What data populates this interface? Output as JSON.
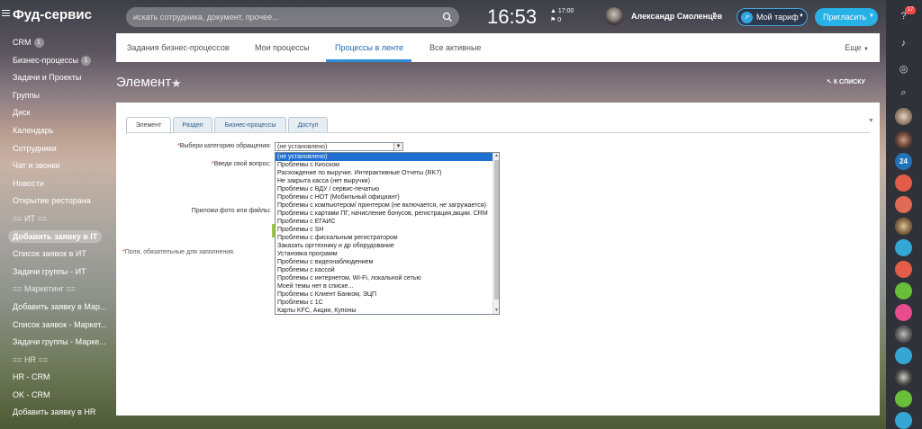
{
  "header": {
    "brand": "Фуд-сервис",
    "search_placeholder": "искать сотрудника, документ, прочее...",
    "time": "16:53",
    "alarm_time": "17:00",
    "flag_count": "0",
    "user_name": "Александр Смоленцев",
    "tariff_label": "Мой тариф",
    "invite_label": "Пригласить",
    "notification_count": "17"
  },
  "sidebar": {
    "items": [
      {
        "label": "CRM",
        "count": "1"
      },
      {
        "label": "Бизнес-процессы",
        "count": "1"
      },
      {
        "label": "Задачи и Проекты"
      },
      {
        "label": "Группы"
      },
      {
        "label": "Диск"
      },
      {
        "label": "Календарь"
      },
      {
        "label": "Сотрудники"
      },
      {
        "label": "Чат и звонки"
      },
      {
        "label": "Новости"
      },
      {
        "label": "Открытие ресторана"
      },
      {
        "label": "== ИТ =="
      },
      {
        "label": "Добавить заявку в IT"
      },
      {
        "label": "Список заявок в ИТ"
      },
      {
        "label": "Задачи группы - ИТ"
      },
      {
        "label": "== Маркетинг =="
      },
      {
        "label": "Добавить заявку в Мар..."
      },
      {
        "label": "Список заявок - Маркет..."
      },
      {
        "label": "Задачи группы - Марке..."
      },
      {
        "label": "== HR =="
      },
      {
        "label": "HR - CRM"
      },
      {
        "label": "OK - CRM"
      },
      {
        "label": "Добавить заявку в HR"
      }
    ]
  },
  "rightpanel": {
    "counter": "24"
  },
  "tabs": {
    "items": [
      "Задания бизнес-процессов",
      "Мои процессы",
      "Процессы в ленте",
      "Все активные"
    ],
    "active": "Процессы в ленте",
    "more": "Еще"
  },
  "page": {
    "title": "Элемент",
    "back_link": "К СПИСКУ"
  },
  "form": {
    "tabs": [
      "Элемент",
      "Раздел",
      "Бизнес-процессы",
      "Доступ"
    ],
    "category_label": "Выбери категорию обращения:",
    "question_label": "Введи свой вопрос:",
    "attach_label": "Приложи фото или файлы:",
    "selected_value": "(не установлено)",
    "required_note": "Поля, обязательные для заполнения."
  },
  "dropdown": {
    "options": [
      "(не установлено)",
      "Проблемы с Киоском",
      "Расхождение по выручке. Интерактивные Отчеты (RK7)",
      "Не закрыта касса (нет выручки)",
      "Проблемы с ВДУ / сервис-печатью",
      "Проблемы с НОТ (Мобильный официант)",
      "Проблемы с компьютером/ принтером (не включается, не загружается)",
      "Проблемы с картами ПГ, начисление бонусов, регистрация,акции. CRM",
      "Проблемы с ЕГАИС",
      "Проблемы с SH",
      "Проблемы с фискальным регистратором",
      "Заказать оргтехнику и др оборудование",
      "Установка программ",
      "Проблемы с видеонаблюдением",
      "Проблемы с кассой",
      "Проблемы с интернетом, Wi-Fi, локальной сетью",
      "Моей темы нет в списке...",
      "Проблемы с Клиент Банком, ЭЦП",
      "Проблемы с 1С",
      "Карты KFC, Акции, Купоны"
    ]
  }
}
